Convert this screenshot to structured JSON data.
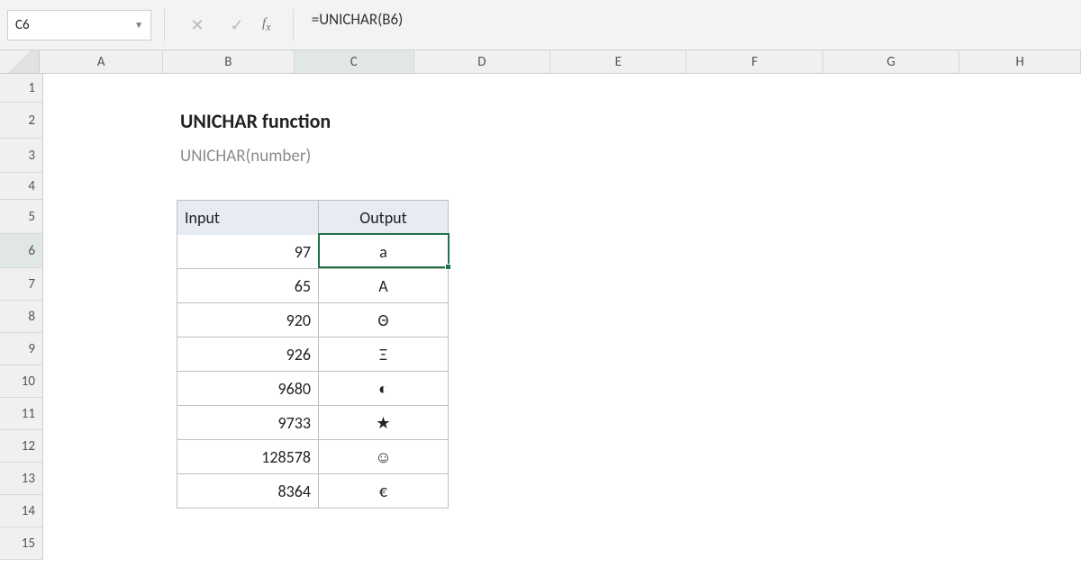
{
  "name_box": "C6",
  "formula": "=UNICHAR(B6)",
  "columns": [
    "A",
    "B",
    "C",
    "D",
    "E",
    "F",
    "G",
    "H"
  ],
  "active_col": "C",
  "rows": [
    "1",
    "2",
    "3",
    "4",
    "5",
    "6",
    "7",
    "8",
    "9",
    "10",
    "11",
    "12",
    "13",
    "14",
    "15"
  ],
  "active_row": "6",
  "title": "UNICHAR function",
  "syntax": "UNICHAR(number)",
  "table": {
    "header": {
      "input": "Input",
      "output": "Output"
    },
    "rows": [
      {
        "input": "97",
        "output": "a"
      },
      {
        "input": "65",
        "output": "A"
      },
      {
        "input": "920",
        "output": "Θ"
      },
      {
        "input": "926",
        "output": "Ξ"
      },
      {
        "input": "9680",
        "output": "◐"
      },
      {
        "input": "9733",
        "output": "★"
      },
      {
        "input": "128578",
        "output": "☺"
      },
      {
        "input": "8364",
        "output": "€"
      }
    ]
  }
}
